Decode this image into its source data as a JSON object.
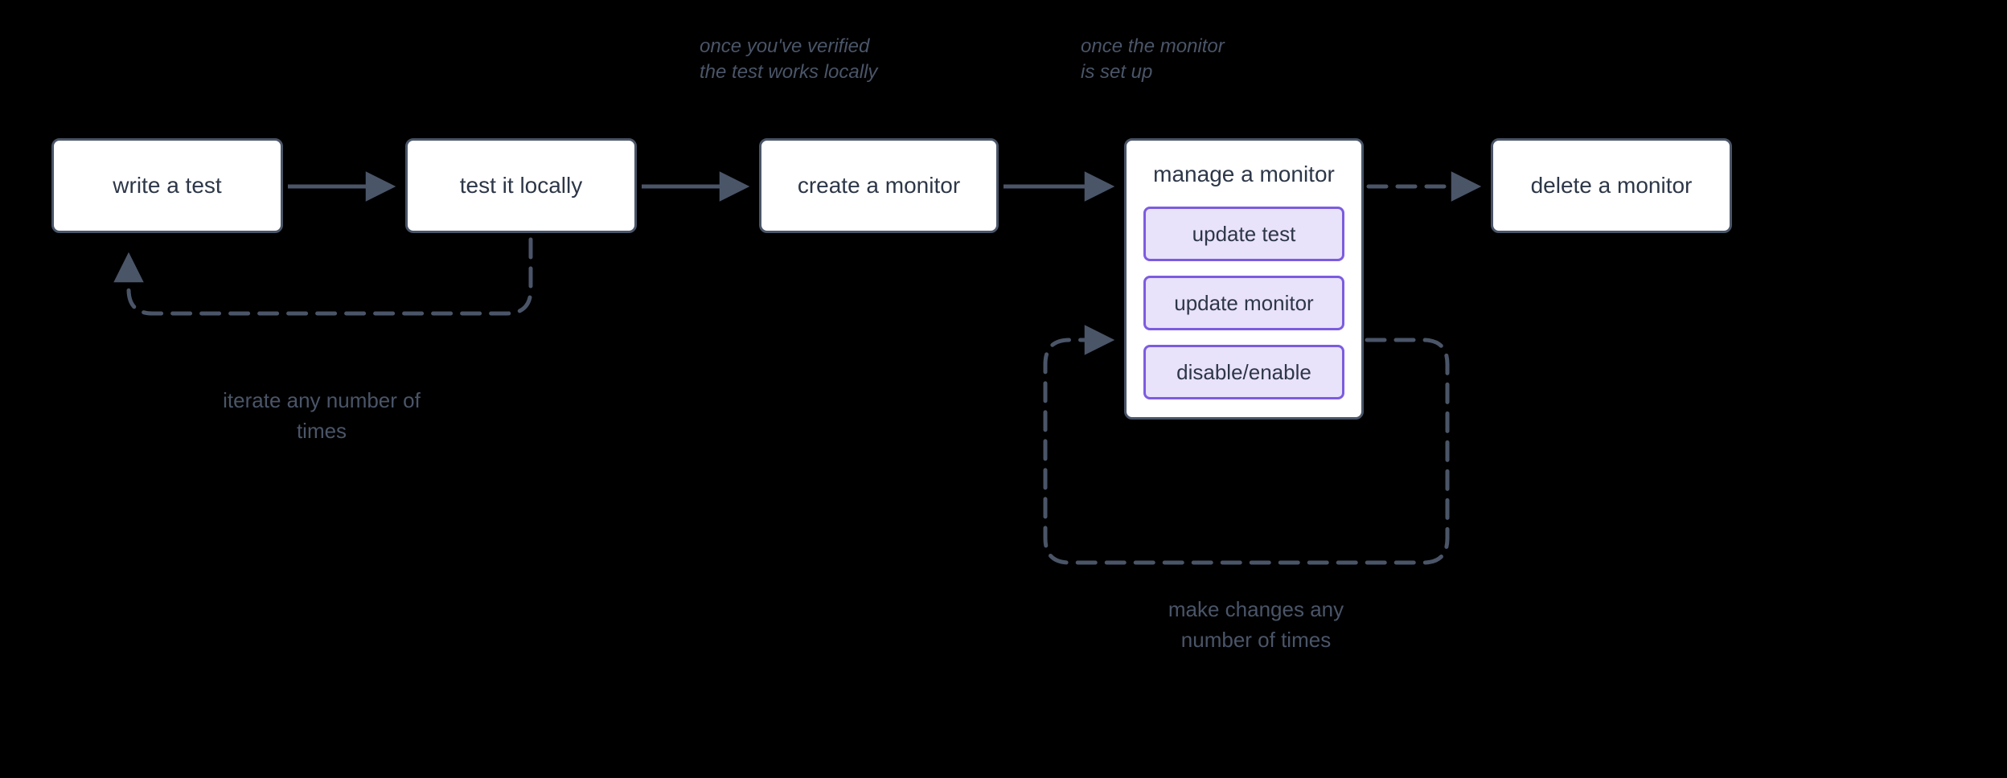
{
  "steps": {
    "write_test": "write a test",
    "test_locally": "test it locally",
    "create_monitor": "create a monitor",
    "manage_monitor": "manage a monitor",
    "delete_monitor": "delete a monitor"
  },
  "manage_subs": {
    "update_test": "update test",
    "update_monitor": "update monitor",
    "disable_enable": "disable/enable"
  },
  "annotations": {
    "verified": "once you've verified the test works locally",
    "monitor_setup": "once the monitor is set up"
  },
  "loops": {
    "iterate": "iterate any number of times",
    "changes": "make changes any number of times"
  }
}
